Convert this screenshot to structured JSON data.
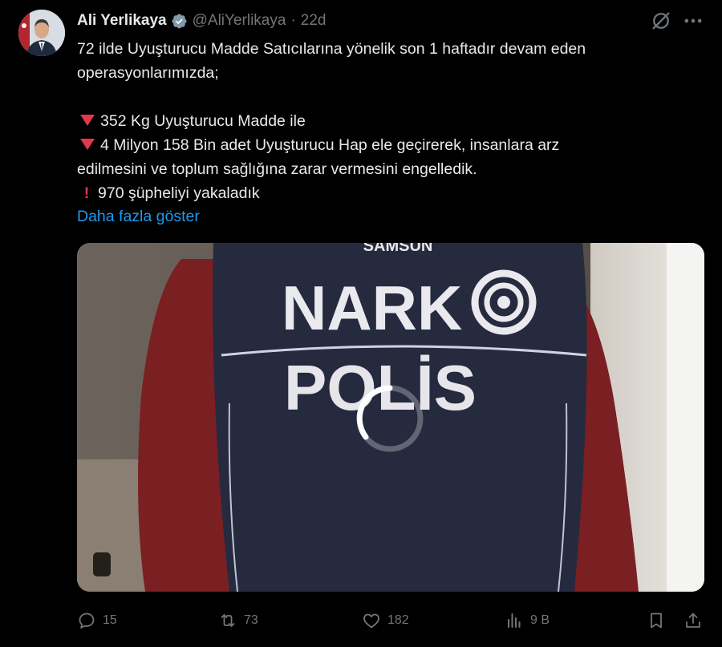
{
  "author": {
    "name": "Ali Yerlikaya",
    "handle": "@AliYerlikaya",
    "separator": "·",
    "time": "22d",
    "verified_color": "#829aab"
  },
  "tweet": {
    "lines": [
      "72 ilde Uyuşturucu Madde Satıcılarına yönelik son 1 haftadır devam eden",
      "operasyonlarımızda;",
      "352 Kg Uyuşturucu Madde ile",
      "4 Milyon 158 Bin adet Uyuşturucu Hap ele geçirerek, insanlara arz",
      "edilmesini ve toplum sağlığına zarar vermesini engelledik.",
      "970 şüpheliyi yakaladık"
    ],
    "show_more": "Daha fazla göster"
  },
  "media": {
    "vest_top_text": "SAMSUN",
    "vest_logo_text": "NARK",
    "vest_text": "POLİS"
  },
  "actions": {
    "replies": "15",
    "retweets": "73",
    "likes": "182",
    "views": "9 B"
  },
  "icons": {
    "top": [
      "grok-slash-icon",
      "more-icon"
    ],
    "actions": [
      "reply-icon",
      "retweet-icon",
      "like-icon",
      "views-icon",
      "bookmark-icon",
      "share-icon"
    ]
  },
  "colors": {
    "background": "#000000",
    "text": "#e7e9ea",
    "muted": "#71767b",
    "link": "#1d9bf0",
    "emoji_red": "#e0394e"
  }
}
